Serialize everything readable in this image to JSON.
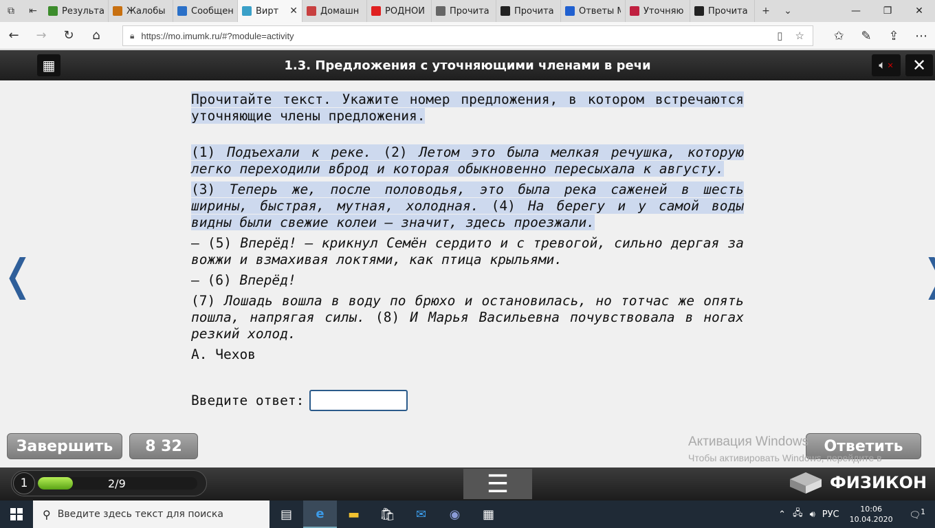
{
  "browser": {
    "tabs": [
      {
        "label": "Результат",
        "icon": "green-book-icon",
        "color": "#3c8c2c"
      },
      {
        "label": "Жалобы",
        "icon": "orange-m-icon",
        "color": "#c87010"
      },
      {
        "label": "Сообщен",
        "icon": "chat-icon",
        "color": "#2a70c8"
      },
      {
        "label": "Вирт",
        "icon": "virt-icon",
        "color": "#3aa0c8",
        "active": true
      },
      {
        "label": "Домашн",
        "icon": "home-doc-icon",
        "color": "#c84040"
      },
      {
        "label": "РОДНОЙ",
        "icon": "youtube-icon",
        "color": "#e02020"
      },
      {
        "label": "Прочита",
        "icon": "page-icon",
        "color": "#666666"
      },
      {
        "label": "Прочита",
        "icon": "z-icon",
        "color": "#222222"
      },
      {
        "label": "Ответы М",
        "icon": "question-icon",
        "color": "#2060d0"
      },
      {
        "label": "Уточняю",
        "icon": "red-circle-icon",
        "color": "#c02040"
      },
      {
        "label": "Прочита",
        "icon": "z-icon",
        "color": "#222222"
      }
    ],
    "url": "https://mo.imumk.ru/#?module=activity"
  },
  "app": {
    "title": "1.3. Предложения с уточняющими членами в речи"
  },
  "task": {
    "instruction": "Прочитайте текст. Укажите номер предложения, в котором встречаются уточняющие члены предложения.",
    "paragraphs": [
      {
        "n1": "(1) ",
        "t1": "Подъехали к реке.",
        "n2": " (2) ",
        "t2": "Летом это была мелкая речушка, которую легко переходили вброд и которая обыкновенно пересыхала к августу."
      },
      {
        "n1": "(3) ",
        "t1": "Теперь же, после половодья, это была река саженей в шесть ширины, быстрая, мутная, холодная.",
        "n2": " (4) ",
        "t2": "На берегу и у самой воды видны были свежие колеи – значит, здесь проезжали."
      },
      {
        "n1": "– (5) ",
        "t1": "Вперёд! – крикнул Семён сердито и с тревогой, сильно дергая за вожжи и взмахивая локтями, как птица крыльями."
      },
      {
        "n1": "– (6) ",
        "t1": "Вперёд!"
      },
      {
        "n1": "(7) ",
        "t1": "Лошадь вошла в воду по брюхо и остановилась, но тотчас же опять пошла, напрягая силы.",
        "n2": " (8) ",
        "t2": "И Марья Васильевна почувствовала в ногах резкий холод."
      }
    ],
    "author": "А. Чехов",
    "answer_label": "Введите ответ:",
    "answer_value": ""
  },
  "controls": {
    "finish_label": "Завершить",
    "timer_label": "8 32",
    "answer_label": "Ответить"
  },
  "watermark": {
    "line1": "Активация Windows",
    "line2": "Чтобы активировать Windows, перейдите в раздел \"Параметры\"."
  },
  "progress": {
    "current": "1",
    "label": "2/9",
    "fraction": 0.22
  },
  "logo": {
    "text": "ФИЗИКОН"
  },
  "taskbar": {
    "search_placeholder": "Введите здесь текст для поиска",
    "lang": "РУС",
    "time": "10:06",
    "date": "10.04.2020",
    "notifications": "1"
  }
}
